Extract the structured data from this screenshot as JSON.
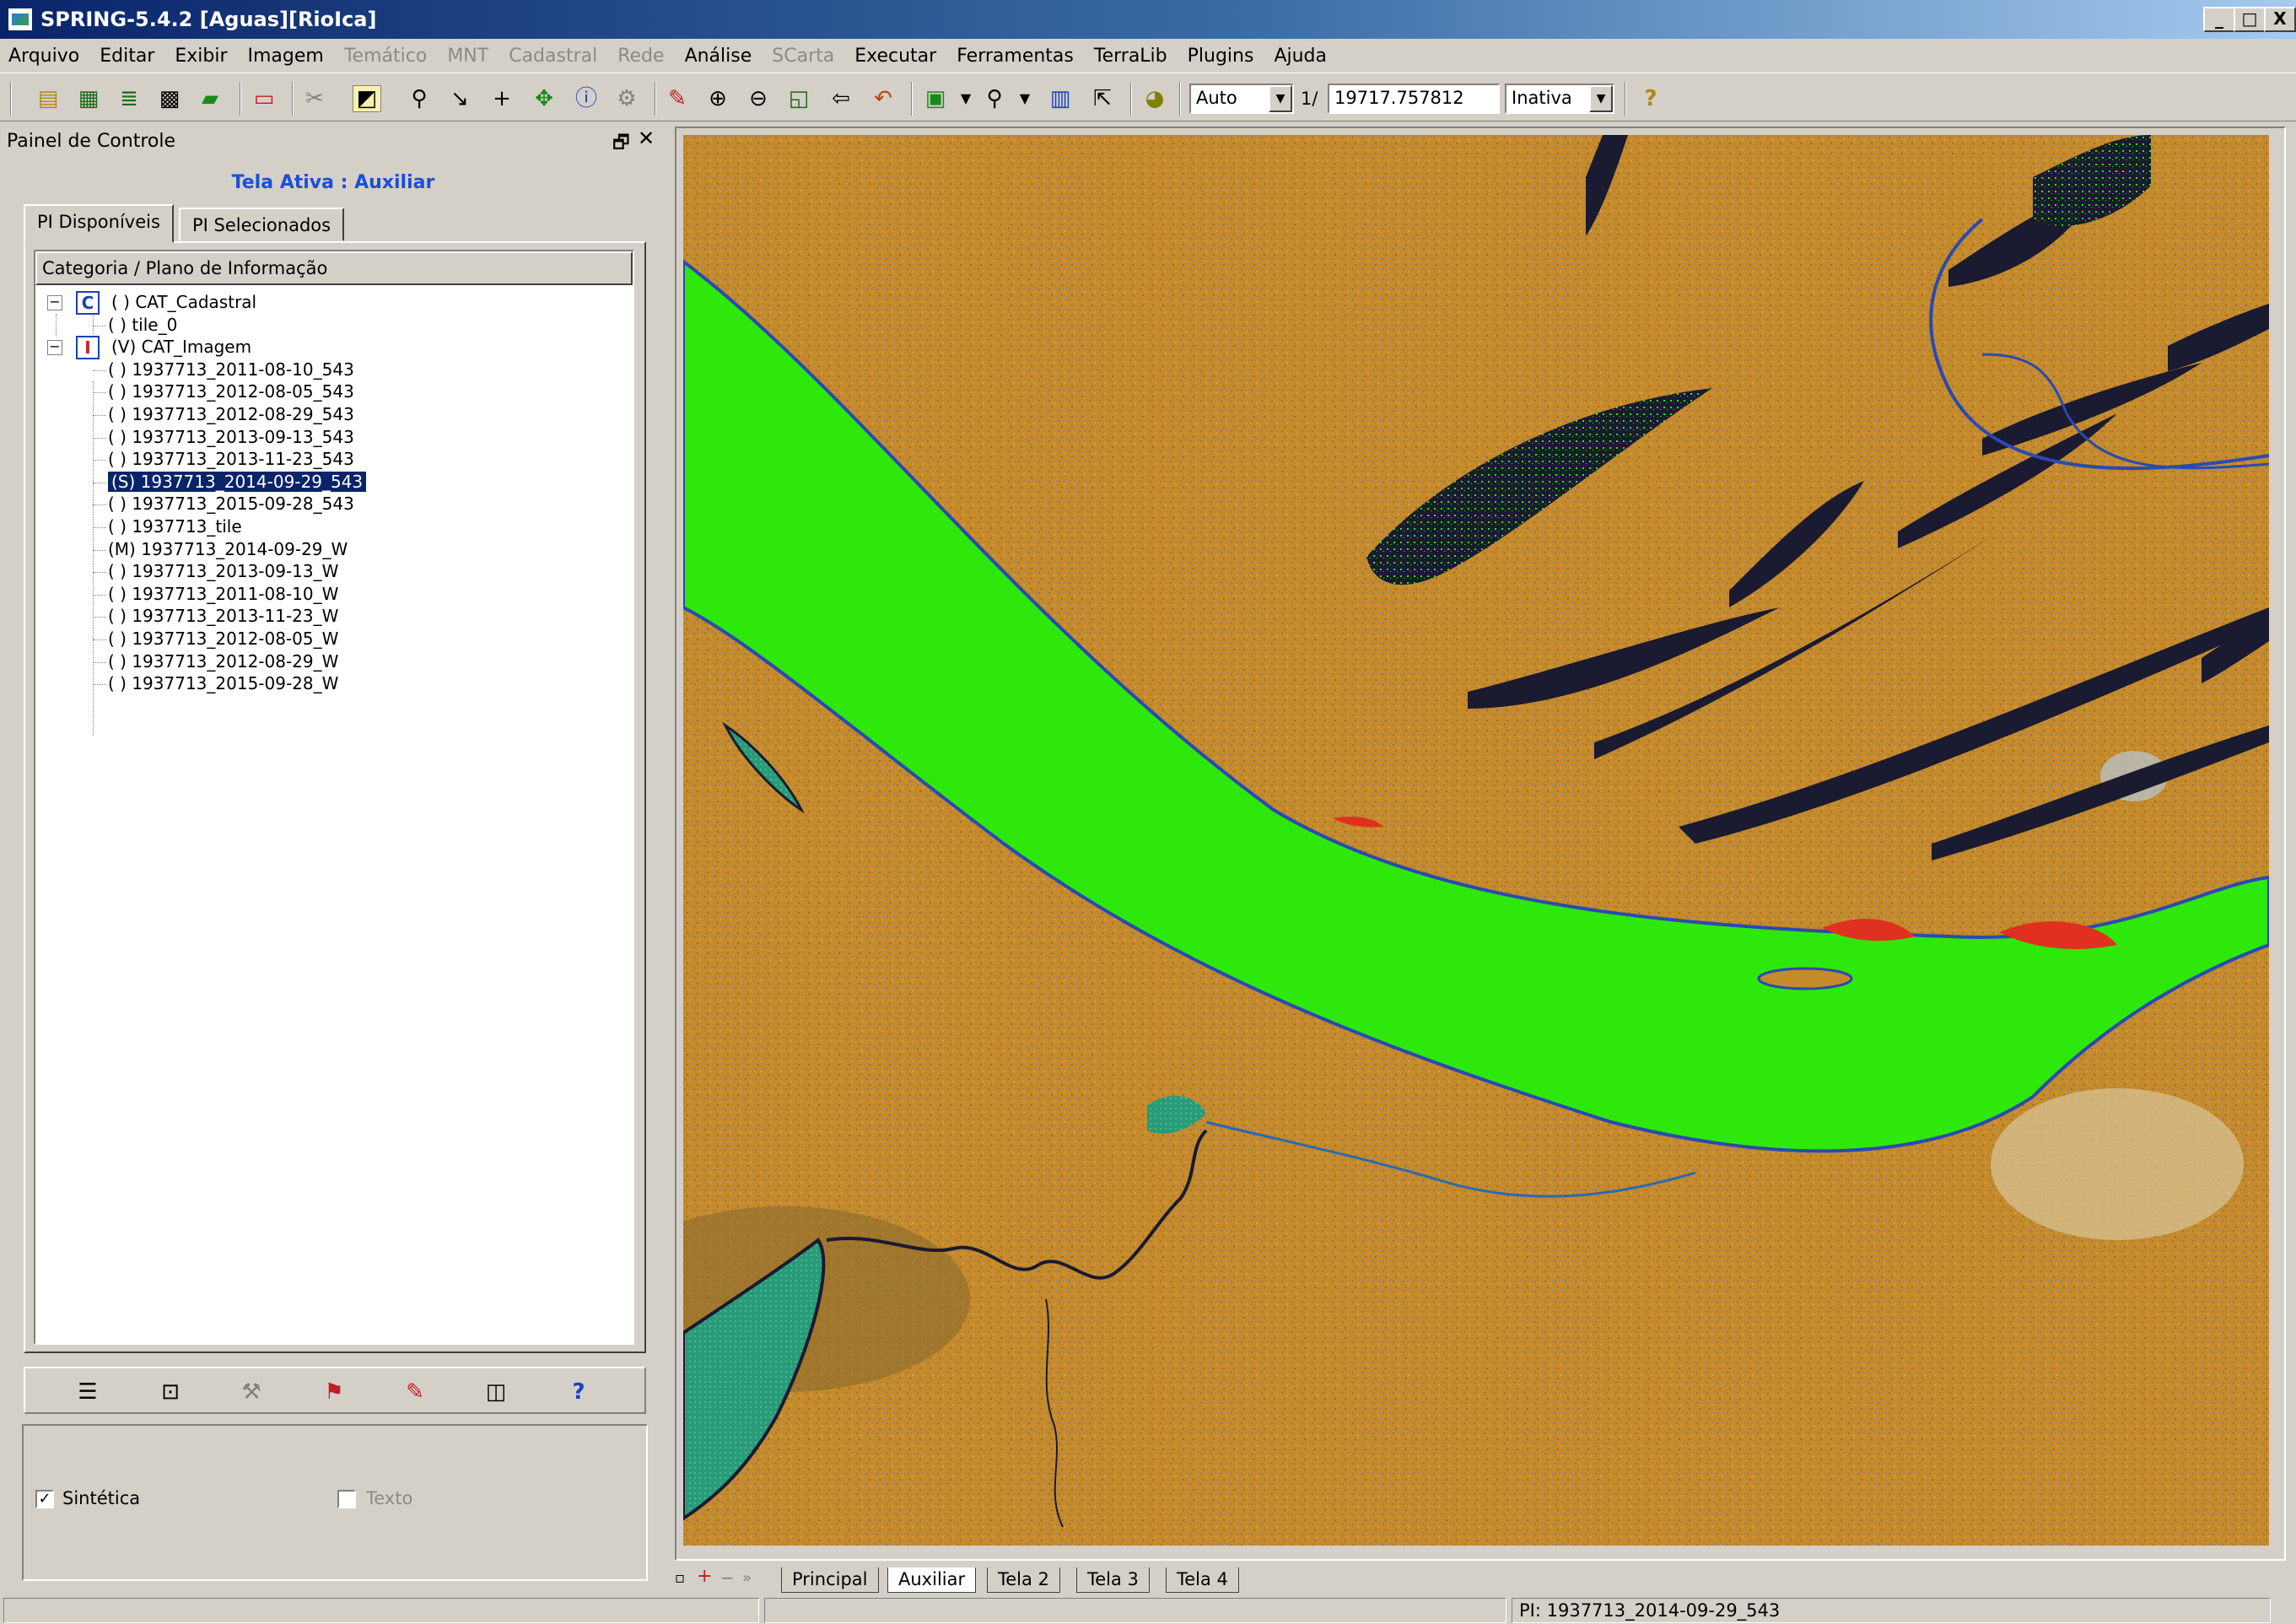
{
  "window": {
    "title": "SPRING-5.4.2 [Aguas][RioIca]",
    "min": "_",
    "max": "□",
    "close": "X"
  },
  "menu": [
    {
      "label": "Arquivo",
      "enabled": true
    },
    {
      "label": "Editar",
      "enabled": true
    },
    {
      "label": "Exibir",
      "enabled": true
    },
    {
      "label": "Imagem",
      "enabled": true
    },
    {
      "label": "Temático",
      "enabled": false
    },
    {
      "label": "MNT",
      "enabled": false
    },
    {
      "label": "Cadastral",
      "enabled": false
    },
    {
      "label": "Rede",
      "enabled": false
    },
    {
      "label": "Análise",
      "enabled": true
    },
    {
      "label": "SCarta",
      "enabled": false
    },
    {
      "label": "Executar",
      "enabled": true
    },
    {
      "label": "Ferramentas",
      "enabled": true
    },
    {
      "label": "TerraLib",
      "enabled": true
    },
    {
      "label": "Plugins",
      "enabled": true
    },
    {
      "label": "Ajuda",
      "enabled": true
    }
  ],
  "toolbar": {
    "scale_mode": "Auto",
    "scale_prefix": "1/",
    "scale_value": "19717.757812",
    "cursor_mode": "Inativa",
    "icons": [
      "database-icon",
      "layers-icon",
      "stack-icon",
      "grid-icon",
      "eraser-icon",
      "window-icon",
      "scissors-icon",
      "palette-icon",
      "search-icon",
      "jump-icon",
      "cross-icon",
      "pan-icon",
      "info-icon",
      "tool-icon",
      "pencil-icon",
      "zoom-in-icon",
      "zoom-out-icon",
      "zoom-area-icon",
      "back-icon",
      "undo-icon",
      "display-icon",
      "zoom-level-icon",
      "frame-icon",
      "cursor-icon",
      "color-icon",
      "help-icon"
    ]
  },
  "panel": {
    "title": "Painel de Controle",
    "active_screen": "Tela Ativa : Auxiliar",
    "tabs": [
      "PI Disponíveis",
      "PI Selecionados"
    ],
    "tree_header": "Categoria / Plano de Informação",
    "tree": [
      {
        "label": "( ) CAT_Cadastral",
        "level": 0,
        "badge": "C",
        "selected": false
      },
      {
        "label": "( ) tile_0",
        "level": 1,
        "selected": false
      },
      {
        "label": "(V) CAT_Imagem",
        "level": 0,
        "badge": "I",
        "selected": false
      },
      {
        "label": "( ) 1937713_2011-08-10_543",
        "level": 1,
        "selected": false
      },
      {
        "label": "( ) 1937713_2012-08-05_543",
        "level": 1,
        "selected": false
      },
      {
        "label": "( ) 1937713_2012-08-29_543",
        "level": 1,
        "selected": false
      },
      {
        "label": "( ) 1937713_2013-09-13_543",
        "level": 1,
        "selected": false
      },
      {
        "label": "( ) 1937713_2013-11-23_543",
        "level": 1,
        "selected": false
      },
      {
        "label": "(S) 1937713_2014-09-29_543",
        "level": 1,
        "selected": true
      },
      {
        "label": "( ) 1937713_2015-09-28_543",
        "level": 1,
        "selected": false
      },
      {
        "label": "( ) 1937713_tile",
        "level": 1,
        "selected": false
      },
      {
        "label": "(M) 1937713_2014-09-29_W",
        "level": 1,
        "selected": false
      },
      {
        "label": "( ) 1937713_2013-09-13_W",
        "level": 1,
        "selected": false
      },
      {
        "label": "( ) 1937713_2011-08-10_W",
        "level": 1,
        "selected": false
      },
      {
        "label": "( ) 1937713_2013-11-23_W",
        "level": 1,
        "selected": false
      },
      {
        "label": "( ) 1937713_2012-08-05_W",
        "level": 1,
        "selected": false
      },
      {
        "label": "( ) 1937713_2012-08-29_W",
        "level": 1,
        "selected": false
      },
      {
        "label": "( ) 1937713_2015-09-28_W",
        "level": 1,
        "selected": false
      }
    ],
    "options": {
      "sintetica_label": "Sintética",
      "sintetica_checked": true,
      "texto_label": "Texto",
      "texto_checked": false
    }
  },
  "screen_tabs": [
    "Principal",
    "Auxiliar",
    "Tela 2",
    "Tela 3",
    "Tela 4"
  ],
  "active_screen_tab": "Auxiliar",
  "status": {
    "pi": "PI: 1937713_2014-09-29_543"
  },
  "colors": {
    "river": "#2ee80c",
    "land": "#c78d2e",
    "water_dark": "#1a1a30",
    "selection": "#0a246a",
    "accent_title": "#1a4fd8"
  }
}
